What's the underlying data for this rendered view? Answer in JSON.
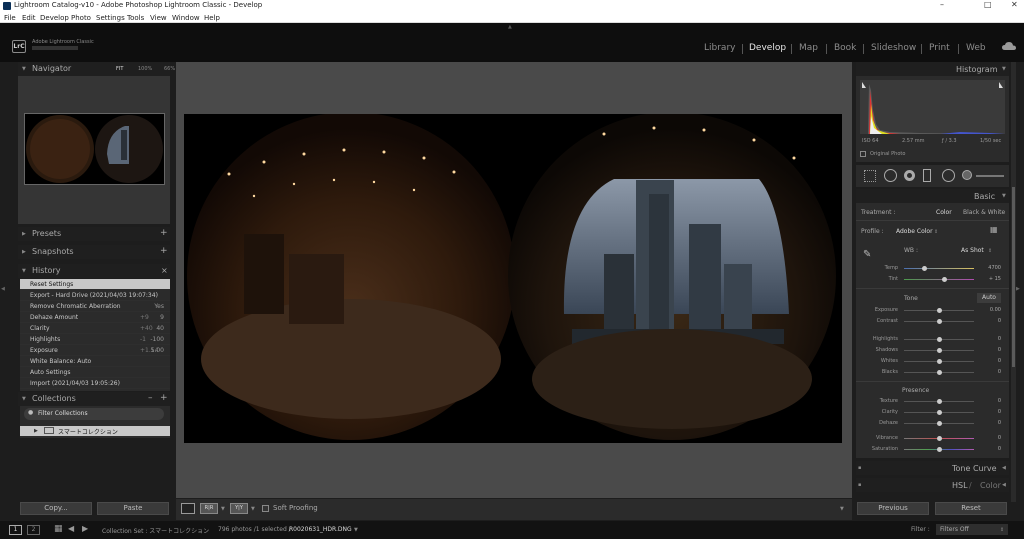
{
  "window": {
    "title": "Lightroom Catalog-v10 - Adobe Photoshop Lightroom Classic - Develop",
    "min": "–",
    "max": "□",
    "close": "✕"
  },
  "menu": [
    "File",
    "Edit",
    "Develop",
    "Photo",
    "Settings",
    "Tools",
    "View",
    "Window",
    "Help"
  ],
  "identity": {
    "logo": "LrC",
    "brand": "Adobe Lightroom Classic"
  },
  "modules": [
    {
      "label": "Library",
      "active": false
    },
    {
      "label": "Develop",
      "active": true
    },
    {
      "label": "Map",
      "active": false
    },
    {
      "label": "Book",
      "active": false
    },
    {
      "label": "Slideshow",
      "active": false
    },
    {
      "label": "Print",
      "active": false
    },
    {
      "label": "Web",
      "active": false
    }
  ],
  "navigator": {
    "title": "Navigator",
    "fit": "FIT",
    "z1": "100%",
    "z2": "66%"
  },
  "presets": {
    "title": "Presets"
  },
  "snapshots": {
    "title": "Snapshots"
  },
  "history": {
    "title": "History",
    "items": [
      {
        "label": "Reset Settings",
        "v1": "",
        "v2": "",
        "selected": true
      },
      {
        "label": "Export - Hard Drive (2021/04/03 19:07:34)",
        "v1": "",
        "v2": "",
        "selected": false
      },
      {
        "label": "Remove Chromatic Aberration",
        "v1": "",
        "v2": "Yes",
        "selected": false
      },
      {
        "label": "Dehaze Amount",
        "v1": "+9",
        "v2": "9",
        "selected": false
      },
      {
        "label": "Clarity",
        "v1": "+40",
        "v2": "40",
        "selected": false
      },
      {
        "label": "Highlights",
        "v1": "-1",
        "v2": "-100",
        "selected": false
      },
      {
        "label": "Exposure",
        "v1": "+1.14",
        "v2": "5.00",
        "selected": false
      },
      {
        "label": "White Balance: Auto",
        "v1": "",
        "v2": "",
        "selected": false
      },
      {
        "label": "Auto Settings",
        "v1": "",
        "v2": "",
        "selected": false
      },
      {
        "label": "Import (2021/04/03 19:05:26)",
        "v1": "",
        "v2": "",
        "selected": false
      }
    ]
  },
  "collections": {
    "title": "Collections",
    "filter": "Filter Collections",
    "item": "スマートコレクション"
  },
  "left_buttons": {
    "copy": "Copy...",
    "paste": "Paste"
  },
  "toolbar": {
    "soft_proofing": "Soft Proofing",
    "compare_label": "Y|Y",
    "before_after": "R|R"
  },
  "histogram": {
    "title": "Histogram",
    "info": [
      "ISO 64",
      "2.57 mm",
      "ƒ / 3.3",
      "1/50 sec"
    ],
    "original_photo": "Original Photo"
  },
  "basic": {
    "title": "Basic",
    "treatment_label": "Treatment :",
    "treatment_color": "Color",
    "treatment_bw": "Black & White",
    "profile_label": "Profile :",
    "profile_value": "Adobe Color",
    "wb_label": "WB :",
    "wb_value": "As Shot",
    "temp": {
      "label": "Temp",
      "value": "4700"
    },
    "tint": {
      "label": "Tint",
      "value": "+ 15"
    },
    "tone_label": "Tone",
    "auto": "Auto",
    "tone": [
      {
        "label": "Exposure",
        "value": "0.00"
      },
      {
        "label": "Contrast",
        "value": "0"
      },
      {
        "label": "Highlights",
        "value": "0"
      },
      {
        "label": "Shadows",
        "value": "0"
      },
      {
        "label": "Whites",
        "value": "0"
      },
      {
        "label": "Blacks",
        "value": "0"
      }
    ],
    "presence_label": "Presence",
    "presence": [
      {
        "label": "Texture",
        "value": "0"
      },
      {
        "label": "Clarity",
        "value": "0"
      },
      {
        "label": "Dehaze",
        "value": "0"
      },
      {
        "label": "Vibrance",
        "value": "0"
      },
      {
        "label": "Saturation",
        "value": "0"
      }
    ]
  },
  "tone_curve": {
    "title": "Tone Curve"
  },
  "hsl": {
    "title": "HSL",
    "sep": " / ",
    "color": "Color"
  },
  "right_buttons": {
    "previous": "Previous",
    "reset": "Reset"
  },
  "filmstrip": {
    "page1": "1",
    "page2": "2",
    "source": "Collection Set : スマートコレクション",
    "count": "796 photos /1 selected /",
    "file": "R0020631_HDR.DNG",
    "filter_label": "Filter :",
    "filter_value": "Filters Off"
  },
  "colors": {
    "panel": "#2b2b2b",
    "header": "#1f1f1f",
    "bg": "#1d1d1d",
    "loupe_bg": "#4a4a4a",
    "selected_row": "#c8c8c8"
  }
}
